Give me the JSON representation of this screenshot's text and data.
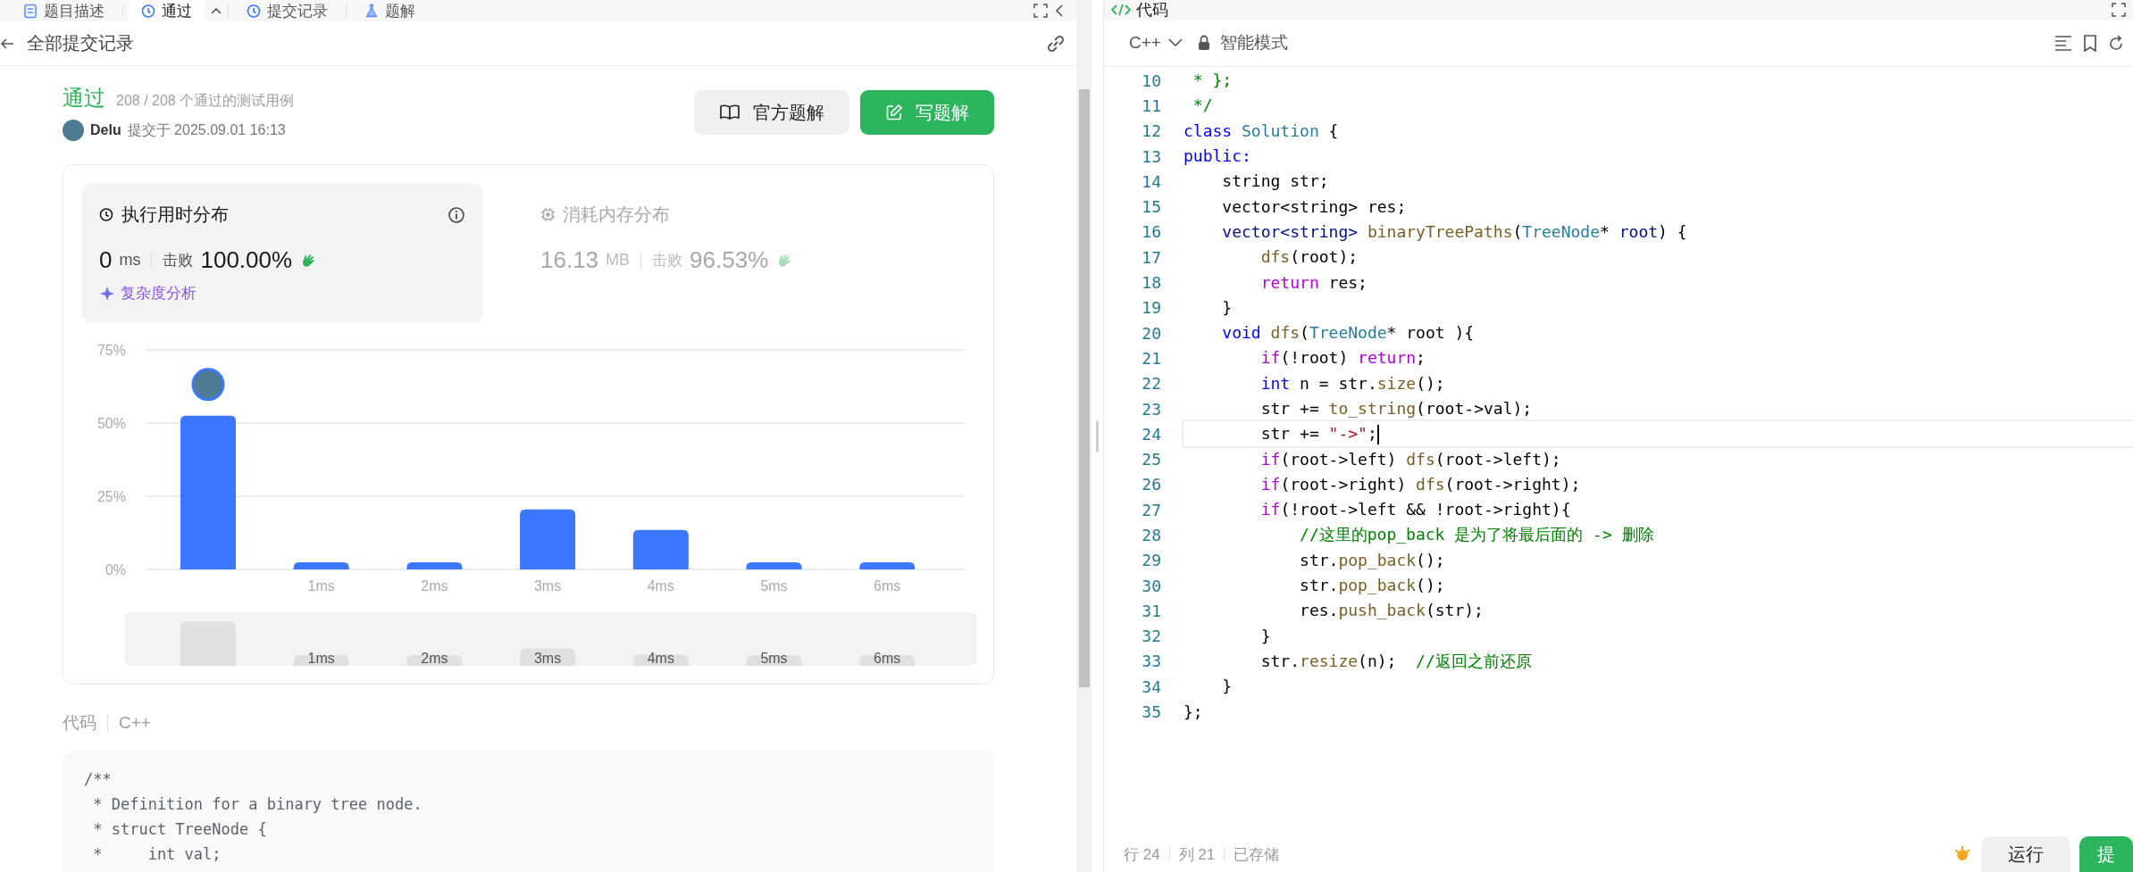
{
  "tabs": [
    {
      "label": "题目描述",
      "kind": "description",
      "selected": false
    },
    {
      "label": "通过",
      "kind": "result",
      "selected": true
    },
    {
      "label": "提交记录",
      "kind": "submissions",
      "selected": false
    },
    {
      "label": "题解",
      "kind": "solutions",
      "selected": false
    }
  ],
  "subheader": {
    "title": "全部提交记录"
  },
  "submission": {
    "status": "通过",
    "cases": "208 / 208 个通过的测试用例",
    "user": "Delu",
    "submitted": "提交于 2025.09.01 16:13",
    "buttons": [
      {
        "label": "官方题解",
        "kind": "secondary"
      },
      {
        "label": "写题解",
        "kind": "primary"
      }
    ]
  },
  "stats": [
    {
      "title": "执行用时分布",
      "kind": "runtime",
      "selected": true,
      "value": "0",
      "unit": "ms",
      "beats_label": "击败",
      "beats": "100.00%",
      "link": "复杂度分析"
    },
    {
      "title": "消耗内存分布",
      "kind": "memory",
      "selected": false,
      "value": "16.13",
      "unit": "MB",
      "beats_label": "击败",
      "beats": "96.53%"
    }
  ],
  "chart_data": {
    "type": "bar",
    "categories": [
      null,
      "1ms",
      "2ms",
      "3ms",
      "4ms",
      "5ms",
      "6ms"
    ],
    "series": [
      {
        "color": "#3b78ff",
        "values": [
          52.5,
          2,
          2,
          20.5,
          13.5,
          2,
          2
        ]
      }
    ],
    "ylim": [
      0,
      75
    ],
    "yticks": [
      {
        "value": 0,
        "label": "0%"
      },
      {
        "value": 25,
        "label": "25%"
      },
      {
        "value": 50,
        "label": "50%"
      },
      {
        "value": 75,
        "label": "75%"
      }
    ]
  },
  "range_selector": {
    "labels": [
      "1ms",
      "2ms",
      "3ms",
      "4ms",
      "5ms",
      "6ms"
    ]
  },
  "code_section": {
    "label": "代码",
    "language": "C++",
    "lines": [
      "/**",
      " * Definition for a binary tree node.",
      " * struct TreeNode {",
      " *     int val;"
    ]
  },
  "editor": {
    "title": "代码",
    "language": "C++",
    "mode": "智能模式",
    "lines": [
      {
        "num": "10",
        "current": false,
        "tokens": [
          {
            "kind": "comment",
            "t": " * };"
          }
        ]
      },
      {
        "num": "11",
        "current": false,
        "tokens": [
          {
            "kind": "comment",
            "t": " */"
          }
        ]
      },
      {
        "num": "12",
        "current": false,
        "tokens": [
          {
            "kind": "keyword",
            "t": "class"
          },
          {
            "kind": "type",
            "t": " Solution"
          },
          {
            "kind": "plain",
            "t": " {"
          }
        ]
      },
      {
        "num": "13",
        "current": false,
        "tokens": [
          {
            "kind": "keyword",
            "t": "public:"
          }
        ]
      },
      {
        "num": "14",
        "current": false,
        "tokens": [
          {
            "kind": "plain",
            "t": "    string str;"
          }
        ]
      },
      {
        "num": "15",
        "current": false,
        "tokens": [
          {
            "kind": "plain",
            "t": "    vector<string> res;"
          }
        ]
      },
      {
        "num": "16",
        "current": false,
        "tokens": [
          {
            "kind": "variable",
            "t": "    vector<string>"
          },
          {
            "kind": "function",
            "t": " binaryTreePaths"
          },
          {
            "kind": "plain",
            "t": "("
          },
          {
            "kind": "type",
            "t": "TreeNode"
          },
          {
            "kind": "plain",
            "t": "* "
          },
          {
            "kind": "variable",
            "t": "root"
          },
          {
            "kind": "plain",
            "t": ") {"
          }
        ]
      },
      {
        "num": "17",
        "current": false,
        "tokens": [
          {
            "kind": "function",
            "t": "        dfs"
          },
          {
            "kind": "plain",
            "t": "(root);"
          }
        ]
      },
      {
        "num": "18",
        "current": false,
        "tokens": [
          {
            "kind": "control",
            "t": "        return"
          },
          {
            "kind": "plain",
            "t": " res;"
          }
        ]
      },
      {
        "num": "19",
        "current": false,
        "tokens": [
          {
            "kind": "plain",
            "t": "    }"
          }
        ]
      },
      {
        "num": "20",
        "current": false,
        "tokens": [
          {
            "kind": "keyword",
            "t": "    void"
          },
          {
            "kind": "function",
            "t": " dfs"
          },
          {
            "kind": "plain",
            "t": "("
          },
          {
            "kind": "type",
            "t": "TreeNode"
          },
          {
            "kind": "plain",
            "t": "* root ){"
          }
        ]
      },
      {
        "num": "21",
        "current": false,
        "tokens": [
          {
            "kind": "control",
            "t": "        if"
          },
          {
            "kind": "plain",
            "t": "(!root) "
          },
          {
            "kind": "control",
            "t": "return"
          },
          {
            "kind": "plain",
            "t": ";"
          }
        ]
      },
      {
        "num": "22",
        "current": false,
        "tokens": [
          {
            "kind": "keyword",
            "t": "        int"
          },
          {
            "kind": "plain",
            "t": " n = str."
          },
          {
            "kind": "function",
            "t": "size"
          },
          {
            "kind": "plain",
            "t": "();"
          }
        ]
      },
      {
        "num": "23",
        "current": false,
        "tokens": [
          {
            "kind": "plain",
            "t": "        str += "
          },
          {
            "kind": "function",
            "t": "to_string"
          },
          {
            "kind": "plain",
            "t": "(root->val);"
          }
        ]
      },
      {
        "num": "24",
        "current": true,
        "tokens": [
          {
            "kind": "plain",
            "t": "        str += "
          },
          {
            "kind": "string",
            "t": "\"->\""
          },
          {
            "kind": "plain",
            "t": ";"
          }
        ]
      },
      {
        "num": "25",
        "current": false,
        "tokens": [
          {
            "kind": "control",
            "t": "        if"
          },
          {
            "kind": "plain",
            "t": "(root->left) "
          },
          {
            "kind": "function",
            "t": "dfs"
          },
          {
            "kind": "plain",
            "t": "(root->left);"
          }
        ]
      },
      {
        "num": "26",
        "current": false,
        "tokens": [
          {
            "kind": "control",
            "t": "        if"
          },
          {
            "kind": "plain",
            "t": "(root->right) "
          },
          {
            "kind": "function",
            "t": "dfs"
          },
          {
            "kind": "plain",
            "t": "(root->right);"
          }
        ]
      },
      {
        "num": "27",
        "current": false,
        "tokens": [
          {
            "kind": "control",
            "t": "        if"
          },
          {
            "kind": "plain",
            "t": "(!root->left && !root->right){"
          }
        ]
      },
      {
        "num": "28",
        "current": false,
        "tokens": [
          {
            "kind": "comment",
            "t": "            //这里的pop_back 是为了将最后面的 -> 删除"
          }
        ]
      },
      {
        "num": "29",
        "current": false,
        "tokens": [
          {
            "kind": "plain",
            "t": "            str."
          },
          {
            "kind": "function",
            "t": "pop_back"
          },
          {
            "kind": "plain",
            "t": "();"
          }
        ]
      },
      {
        "num": "30",
        "current": false,
        "tokens": [
          {
            "kind": "plain",
            "t": "            str."
          },
          {
            "kind": "function",
            "t": "pop_back"
          },
          {
            "kind": "plain",
            "t": "();"
          }
        ]
      },
      {
        "num": "31",
        "current": false,
        "tokens": [
          {
            "kind": "plain",
            "t": "            res."
          },
          {
            "kind": "function",
            "t": "push_back"
          },
          {
            "kind": "plain",
            "t": "(str);"
          }
        ]
      },
      {
        "num": "32",
        "current": false,
        "tokens": [
          {
            "kind": "plain",
            "t": "        }"
          }
        ]
      },
      {
        "num": "33",
        "current": false,
        "tokens": [
          {
            "kind": "plain",
            "t": "        str."
          },
          {
            "kind": "function",
            "t": "resize"
          },
          {
            "kind": "plain",
            "t": "(n);  "
          },
          {
            "kind": "comment",
            "t": "//返回之前还原"
          }
        ]
      },
      {
        "num": "34",
        "current": false,
        "tokens": [
          {
            "kind": "plain",
            "t": "    }"
          }
        ]
      },
      {
        "num": "35",
        "current": false,
        "tokens": [
          {
            "kind": "plain",
            "t": "};"
          }
        ]
      }
    ],
    "status": [
      "行 24",
      "列 21",
      "已存储"
    ],
    "buttons": [
      {
        "label": "运行",
        "kind": "secondary"
      },
      {
        "label": "提",
        "kind": "primary"
      }
    ]
  }
}
